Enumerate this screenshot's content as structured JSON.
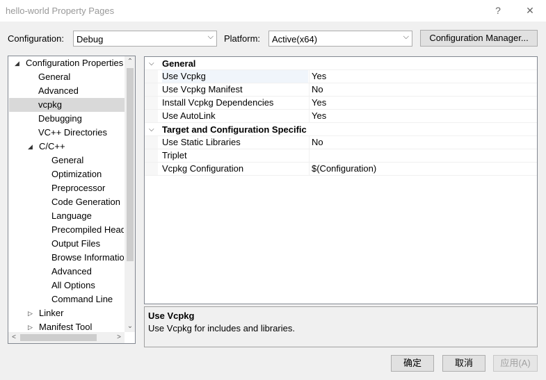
{
  "window": {
    "title": "hello-world Property Pages",
    "help_glyph": "?",
    "close_glyph": "✕"
  },
  "toolbar": {
    "configuration_label": "Configuration:",
    "configuration_value": "Debug",
    "platform_label": "Platform:",
    "platform_value": "Active(x64)",
    "config_manager_label": "Configuration Manager..."
  },
  "tree": {
    "items": [
      {
        "label": "Configuration Properties",
        "expander": "◢"
      },
      {
        "label": "General"
      },
      {
        "label": "Advanced"
      },
      {
        "label": "vcpkg"
      },
      {
        "label": "Debugging"
      },
      {
        "label": "VC++ Directories"
      },
      {
        "label": "C/C++",
        "expander": "◢"
      },
      {
        "label": "General"
      },
      {
        "label": "Optimization"
      },
      {
        "label": "Preprocessor"
      },
      {
        "label": "Code Generation"
      },
      {
        "label": "Language"
      },
      {
        "label": "Precompiled Headers"
      },
      {
        "label": "Output Files"
      },
      {
        "label": "Browse Information"
      },
      {
        "label": "Advanced"
      },
      {
        "label": "All Options"
      },
      {
        "label": "Command Line"
      },
      {
        "label": "Linker",
        "expander": "▷"
      },
      {
        "label": "Manifest Tool",
        "expander": "▷"
      }
    ],
    "selected": "vcpkg"
  },
  "grid": {
    "categories": [
      {
        "title": "General",
        "rows": [
          {
            "name": "Use Vcpkg",
            "value": "Yes"
          },
          {
            "name": "Use Vcpkg Manifest",
            "value": "No"
          },
          {
            "name": "Install Vcpkg Dependencies",
            "value": "Yes"
          },
          {
            "name": "Use AutoLink",
            "value": "Yes"
          }
        ]
      },
      {
        "title": "Target and Configuration Specific",
        "rows": [
          {
            "name": "Use Static Libraries",
            "value": "No"
          },
          {
            "name": "Triplet",
            "value": ""
          },
          {
            "name": "Vcpkg Configuration",
            "value": "$(Configuration)"
          }
        ]
      }
    ]
  },
  "description": {
    "title": "Use Vcpkg",
    "body": "Use Vcpkg for includes and libraries."
  },
  "buttons": {
    "ok": "确定",
    "cancel": "取消",
    "apply": "应用(A)"
  }
}
